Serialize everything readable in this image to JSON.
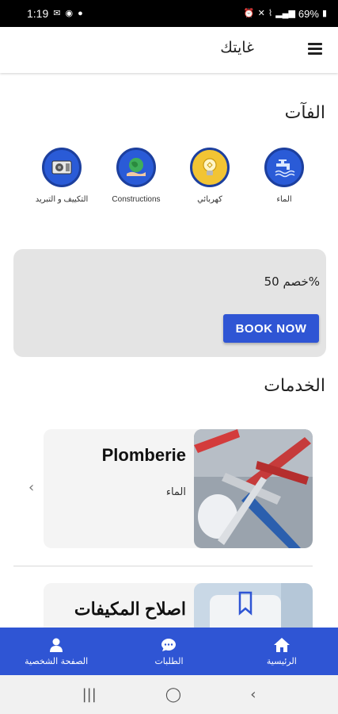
{
  "status_bar": {
    "time": "1:19",
    "battery": "69%"
  },
  "app_bar": {
    "title": "غايتك"
  },
  "categories_section": {
    "title": "الفآت",
    "items": [
      {
        "label": "الماء",
        "icon": "faucet-icon"
      },
      {
        "label": "كهربائي",
        "icon": "lightbulb-icon"
      },
      {
        "label": "Constructions",
        "icon": "globe-hand-icon"
      },
      {
        "label": "التكييف و التبريد",
        "icon": "air-conditioner-icon"
      }
    ]
  },
  "promo": {
    "text": "خصم 50%",
    "button_label": "BOOK NOW"
  },
  "services_section": {
    "title": "الخدمات",
    "items": [
      {
        "title": "Plomberie",
        "subtitle": "الماء"
      },
      {
        "title": "اصلاح المكيفات",
        "subtitle": ""
      }
    ]
  },
  "bottom_nav": {
    "items": [
      {
        "label": "الصفحة الشخصية",
        "icon": "person-icon"
      },
      {
        "label": "الطلبات",
        "icon": "chat-icon"
      },
      {
        "label": "الرئيسية",
        "icon": "home-icon"
      }
    ]
  },
  "colors": {
    "primary": "#2f55d4",
    "category_circle": "#2a5bd7",
    "promo_bg": "#e4e4e4"
  }
}
